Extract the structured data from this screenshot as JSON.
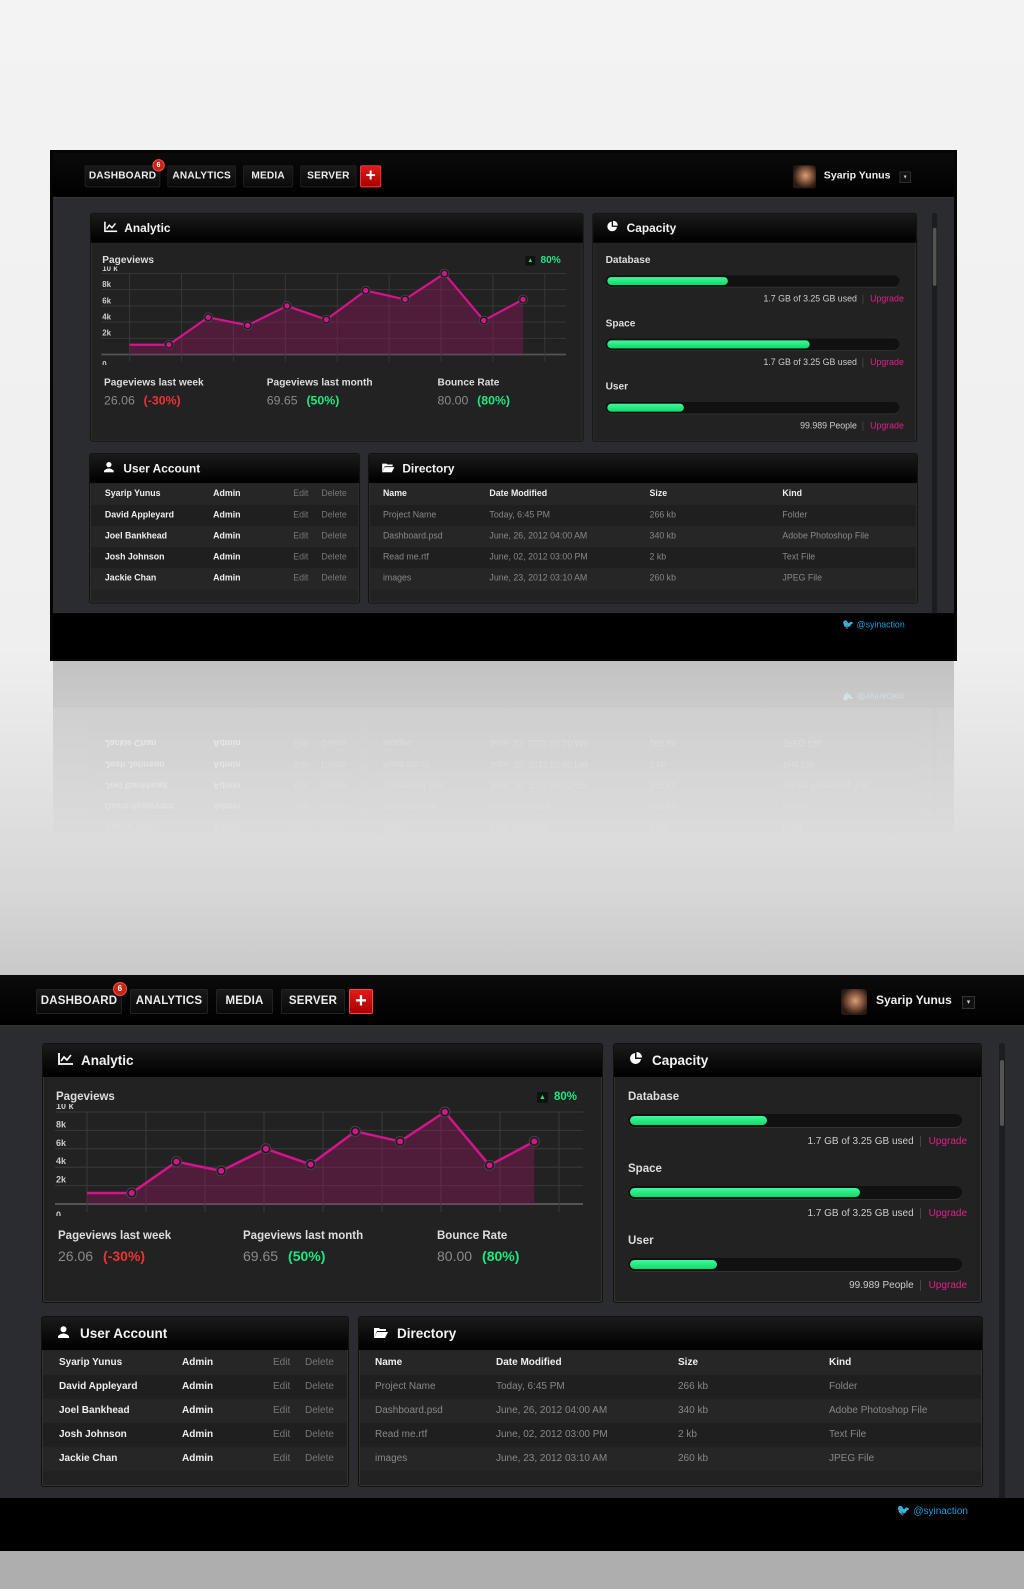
{
  "nav": {
    "items": [
      {
        "label": "DASHBOARD",
        "badge": "6"
      },
      {
        "label": "ANALYTICS"
      },
      {
        "label": "MEDIA"
      },
      {
        "label": "SERVER"
      }
    ],
    "add_label": "+",
    "user_name": "Syarip Yunus",
    "dropdown_icon": "▾"
  },
  "analytic": {
    "title": "Analytic",
    "icon": "line-chart-icon",
    "chart_title": "Pageviews",
    "trend_label": "80%",
    "stats": [
      {
        "label": "Pageviews last week",
        "value": "26.06",
        "change": "(-30%)"
      },
      {
        "label": "Pageviews last month",
        "value": "69.65",
        "change": "(50%)"
      },
      {
        "label": "Bounce Rate",
        "value": "80.00",
        "change": "(80%)"
      }
    ]
  },
  "chart_data": {
    "type": "area",
    "title": "Pageviews",
    "y_tick_labels": [
      "0",
      "2k",
      "4k",
      "6k",
      "8k",
      "10 k"
    ],
    "ylim": [
      0,
      10000
    ],
    "grid": true,
    "line_color": "#d4148c",
    "x": [
      0,
      1,
      2,
      3,
      4,
      5,
      6,
      7,
      8,
      9,
      10,
      11
    ],
    "values": [
      1200,
      1200,
      4600,
      3600,
      6000,
      4300,
      7900,
      6800,
      10000,
      4200,
      6800,
      null
    ]
  },
  "capacity": {
    "title": "Capacity",
    "icon": "pie-chart-icon",
    "items": [
      {
        "label": "Database",
        "fill": 0.41,
        "text": "1.7 GB of 3.25 GB used",
        "link": "Upgrade"
      },
      {
        "label": "Space",
        "fill": 0.69,
        "text": "1.7 GB of 3.25 GB used",
        "link": "Upgrade"
      },
      {
        "label": "User",
        "fill": 0.26,
        "text": "99.989 People",
        "link": "Upgrade"
      }
    ]
  },
  "users": {
    "title": "User Account",
    "icon": "user-icon",
    "rows": [
      {
        "name": "Syarip Yunus",
        "role": "Admin",
        "edit": "Edit",
        "delete": "Delete"
      },
      {
        "name": "David Appleyard",
        "role": "Admin",
        "edit": "Edit",
        "delete": "Delete"
      },
      {
        "name": "Joel Bankhead",
        "role": "Admin",
        "edit": "Edit",
        "delete": "Delete"
      },
      {
        "name": "Josh Johnson",
        "role": "Admin",
        "edit": "Edit",
        "delete": "Delete"
      },
      {
        "name": "Jackie Chan",
        "role": "Admin",
        "edit": "Edit",
        "delete": "Delete"
      }
    ]
  },
  "directory": {
    "title": "Directory",
    "icon": "folder-icon",
    "columns": [
      "Name",
      "Date Modified",
      "Size",
      "Kind"
    ],
    "rows": [
      [
        "Project Name",
        "Today, 6:45 PM",
        "266 kb",
        "Folder"
      ],
      [
        "Dashboard.psd",
        "June, 26, 2012  04:00 AM",
        "340 kb",
        "Adobe Photoshop File"
      ],
      [
        "Read me.rtf",
        "June, 02, 2012  03:00 PM",
        "2 kb",
        "Text File"
      ],
      [
        "images",
        "June, 23, 2012  03:10 AM",
        "260 kb",
        "JPEG File"
      ]
    ]
  },
  "footer": {
    "twitter": "@syinaction"
  },
  "colors": {
    "accent": "#d4148c",
    "positive": "#1de87f",
    "negative": "#e33333",
    "add": "#d81010",
    "twitter": "#1aa0e0"
  }
}
